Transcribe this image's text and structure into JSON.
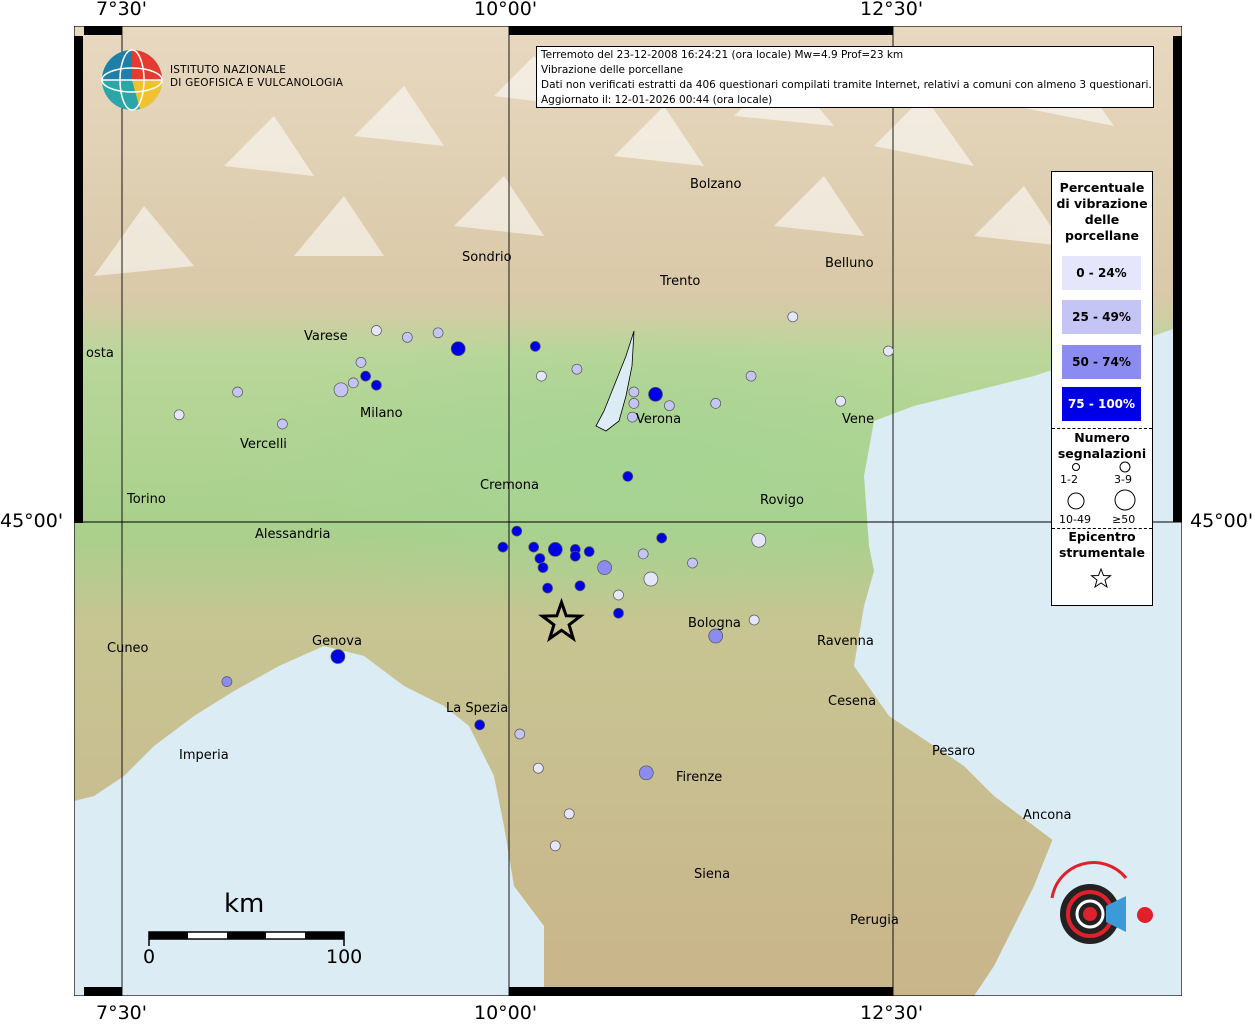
{
  "info": {
    "line1": "Terremoto del 23-12-2008 16:24:21 (ora locale) Mw=4.9 Prof=23 km",
    "line2": "Vibrazione delle porcellane",
    "line3": "Dati non verificati estratti da 406 questionari compilati tramite Internet, relativi a comuni con almeno 3 questionari.",
    "line4": "Aggiornato il: 12-01-2026 00:44 (ora locale)"
  },
  "logo": {
    "line1": "ISTITUTO NAZIONALE",
    "line2": "DI GEOFISICA E VULCANOLOGIA"
  },
  "coords": {
    "top_left": "7°30'",
    "top_mid": "10°00'",
    "top_right": "12°30'",
    "bottom_left": "7°30'",
    "bottom_mid": "10°00'",
    "bottom_right": "12°30'",
    "left_lat": "45°00'",
    "right_lat": "45°00'"
  },
  "legend": {
    "title": "Percentuale di vibrazione delle porcellane",
    "title_lines": [
      "Percentuale",
      "di vibrazione",
      "delle",
      "porcellane"
    ],
    "classes": [
      {
        "label": "0 - 24%",
        "color": "#e5e5fb"
      },
      {
        "label": "25 - 49%",
        "color": "#c4c4f5"
      },
      {
        "label": "50 - 74%",
        "color": "#8c8cf0"
      },
      {
        "label": "75 - 100%",
        "color": "#0000e6"
      }
    ],
    "count_title_lines": [
      "Numero",
      "segnalazioni"
    ],
    "count_labels": [
      "1-2",
      "3-9",
      "10-49",
      "≥50"
    ],
    "epicenter_lines": [
      "Epicentro",
      "strumentale"
    ]
  },
  "cities": [
    {
      "name": "Bolzano"
    },
    {
      "name": "Sondrio"
    },
    {
      "name": "Trento"
    },
    {
      "name": "Belluno"
    },
    {
      "name": "Varese"
    },
    {
      "name": "osta"
    },
    {
      "name": "Milano"
    },
    {
      "name": "Verona"
    },
    {
      "name": "Vene"
    },
    {
      "name": "Vercelli"
    },
    {
      "name": "Cremona"
    },
    {
      "name": "Rovigo"
    },
    {
      "name": "Torino"
    },
    {
      "name": "Alessandria"
    },
    {
      "name": "Bologna"
    },
    {
      "name": "Ravenna"
    },
    {
      "name": "Genova"
    },
    {
      "name": "Cuneo"
    },
    {
      "name": "Cesena"
    },
    {
      "name": "La Spezia"
    },
    {
      "name": "Pesaro"
    },
    {
      "name": "Imperia"
    },
    {
      "name": "Firenze"
    },
    {
      "name": "Ancona"
    },
    {
      "name": "Siena"
    },
    {
      "name": "Perugia"
    }
  ],
  "scale": {
    "unit": "km",
    "min": "0",
    "max": "100"
  },
  "points": [
    {
      "lon": 9.15,
      "lat": 45.84,
      "pct": 10,
      "n": 3
    },
    {
      "lon": 9.35,
      "lat": 45.81,
      "pct": 40,
      "n": 3
    },
    {
      "lon": 9.55,
      "lat": 45.83,
      "pct": 40,
      "n": 3
    },
    {
      "lon": 8.25,
      "lat": 45.57,
      "pct": 40,
      "n": 3
    },
    {
      "lon": 9.0,
      "lat": 45.61,
      "pct": 30,
      "n": 3
    },
    {
      "lon": 9.05,
      "lat": 45.7,
      "pct": 40,
      "n": 3
    },
    {
      "lon": 9.08,
      "lat": 45.64,
      "pct": 90,
      "n": 5
    },
    {
      "lon": 9.15,
      "lat": 45.6,
      "pct": 90,
      "n": 5
    },
    {
      "lon": 8.92,
      "lat": 45.58,
      "pct": 30,
      "n": 10
    },
    {
      "lon": 7.87,
      "lat": 45.47,
      "pct": 10,
      "n": 3
    },
    {
      "lon": 8.54,
      "lat": 45.43,
      "pct": 40,
      "n": 3
    },
    {
      "lon": 9.68,
      "lat": 45.76,
      "pct": 90,
      "n": 12
    },
    {
      "lon": 10.18,
      "lat": 45.77,
      "pct": 90,
      "n": 3
    },
    {
      "lon": 10.22,
      "lat": 45.64,
      "pct": 10,
      "n": 3
    },
    {
      "lon": 10.45,
      "lat": 45.67,
      "pct": 40,
      "n": 3
    },
    {
      "lon": 10.82,
      "lat": 45.57,
      "pct": 40,
      "n": 3
    },
    {
      "lon": 10.82,
      "lat": 45.52,
      "pct": 40,
      "n": 3
    },
    {
      "lon": 10.81,
      "lat": 45.46,
      "pct": 40,
      "n": 3
    },
    {
      "lon": 10.96,
      "lat": 45.56,
      "pct": 90,
      "n": 10
    },
    {
      "lon": 11.05,
      "lat": 45.51,
      "pct": 30,
      "n": 3
    },
    {
      "lon": 11.35,
      "lat": 45.52,
      "pct": 40,
      "n": 3
    },
    {
      "lon": 11.58,
      "lat": 45.64,
      "pct": 40,
      "n": 3
    },
    {
      "lon": 12.16,
      "lat": 45.53,
      "pct": 10,
      "n": 3
    },
    {
      "lon": 12.47,
      "lat": 45.75,
      "pct": 10,
      "n": 3
    },
    {
      "lon": 11.85,
      "lat": 45.9,
      "pct": 10,
      "n": 3
    },
    {
      "lon": 10.78,
      "lat": 45.2,
      "pct": 90,
      "n": 3
    },
    {
      "lon": 10.06,
      "lat": 44.96,
      "pct": 90,
      "n": 5
    },
    {
      "lon": 9.97,
      "lat": 44.89,
      "pct": 90,
      "n": 5
    },
    {
      "lon": 10.17,
      "lat": 44.89,
      "pct": 90,
      "n": 5
    },
    {
      "lon": 10.31,
      "lat": 44.88,
      "pct": 90,
      "n": 12
    },
    {
      "lon": 10.44,
      "lat": 44.88,
      "pct": 90,
      "n": 5
    },
    {
      "lon": 10.44,
      "lat": 44.85,
      "pct": 90,
      "n": 5
    },
    {
      "lon": 10.53,
      "lat": 44.87,
      "pct": 90,
      "n": 5
    },
    {
      "lon": 10.21,
      "lat": 44.84,
      "pct": 90,
      "n": 5
    },
    {
      "lon": 10.23,
      "lat": 44.8,
      "pct": 90,
      "n": 5
    },
    {
      "lon": 10.63,
      "lat": 44.8,
      "pct": 60,
      "n": 12
    },
    {
      "lon": 10.47,
      "lat": 44.72,
      "pct": 90,
      "n": 5
    },
    {
      "lon": 10.26,
      "lat": 44.71,
      "pct": 90,
      "n": 5
    },
    {
      "lon": 10.88,
      "lat": 44.86,
      "pct": 30,
      "n": 3
    },
    {
      "lon": 10.93,
      "lat": 44.75,
      "pct": 20,
      "n": 10
    },
    {
      "lon": 10.72,
      "lat": 44.68,
      "pct": 20,
      "n": 3
    },
    {
      "lon": 10.72,
      "lat": 44.6,
      "pct": 90,
      "n": 5
    },
    {
      "lon": 11.0,
      "lat": 44.93,
      "pct": 90,
      "n": 5
    },
    {
      "lon": 11.2,
      "lat": 44.82,
      "pct": 30,
      "n": 3
    },
    {
      "lon": 11.35,
      "lat": 44.5,
      "pct": 60,
      "n": 10
    },
    {
      "lon": 11.6,
      "lat": 44.57,
      "pct": 20,
      "n": 3
    },
    {
      "lon": 11.63,
      "lat": 44.92,
      "pct": 10,
      "n": 12
    },
    {
      "lon": 8.9,
      "lat": 44.41,
      "pct": 90,
      "n": 10
    },
    {
      "lon": 8.18,
      "lat": 44.3,
      "pct": 60,
      "n": 3
    },
    {
      "lon": 9.82,
      "lat": 44.11,
      "pct": 90,
      "n": 3
    },
    {
      "lon": 10.08,
      "lat": 44.07,
      "pct": 40,
      "n": 3
    },
    {
      "lon": 10.2,
      "lat": 43.92,
      "pct": 10,
      "n": 3
    },
    {
      "lon": 10.9,
      "lat": 43.9,
      "pct": 60,
      "n": 10
    },
    {
      "lon": 10.4,
      "lat": 43.72,
      "pct": 10,
      "n": 3
    },
    {
      "lon": 10.31,
      "lat": 43.58,
      "pct": 10,
      "n": 3
    }
  ],
  "epicenter": {
    "lon": 10.35,
    "lat": 44.56
  }
}
